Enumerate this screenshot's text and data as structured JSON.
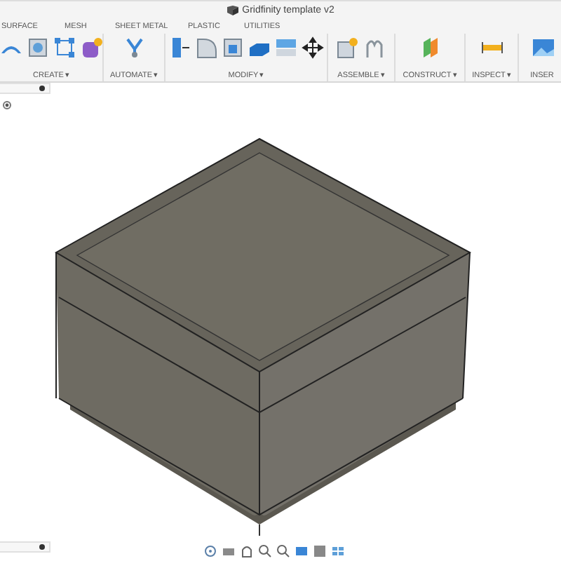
{
  "window": {
    "title": "Gridfinity template v2"
  },
  "tabs": [
    {
      "label": "SURFACE"
    },
    {
      "label": "MESH"
    },
    {
      "label": "SHEET METAL"
    },
    {
      "label": "PLASTIC"
    },
    {
      "label": "UTILITIES"
    }
  ],
  "toolbar_groups": [
    {
      "label": "CREATE",
      "dropdown": "▾"
    },
    {
      "label": "AUTOMATE",
      "dropdown": "▾"
    },
    {
      "label": "MODIFY",
      "dropdown": "▾"
    },
    {
      "label": "ASSEMBLE",
      "dropdown": "▾"
    },
    {
      "label": "CONSTRUCT",
      "dropdown": "▾"
    },
    {
      "label": "INSPECT",
      "dropdown": "▾"
    },
    {
      "label": "INSER"
    }
  ]
}
